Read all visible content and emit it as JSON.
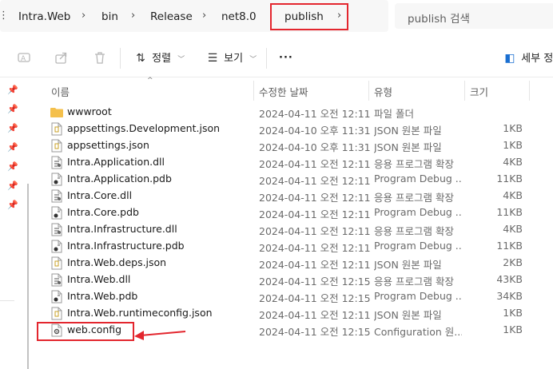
{
  "breadcrumb": {
    "items": [
      "Intra.Web",
      "bin",
      "Release",
      "net8.0",
      "publish"
    ]
  },
  "search": {
    "placeholder": "publish 검색"
  },
  "toolbar": {
    "sort_label": "정렬",
    "view_label": "보기",
    "details_label": "세부 정",
    "more_label": "···"
  },
  "columns": {
    "name": "이름",
    "date": "수정한 날짜",
    "type": "유형",
    "size": "크기"
  },
  "files": [
    {
      "name": "wwwroot",
      "date": "2024-04-11 오전 12:11",
      "type": "파일 폴더",
      "size": "",
      "icon": "folder-icon"
    },
    {
      "name": "appsettings.Development.json",
      "date": "2024-04-10 오후 11:31",
      "type": "JSON 원본 파일",
      "size": "1KB",
      "icon": "json-file-icon"
    },
    {
      "name": "appsettings.json",
      "date": "2024-04-10 오후 11:31",
      "type": "JSON 원본 파일",
      "size": "1KB",
      "icon": "json-file-icon"
    },
    {
      "name": "Intra.Application.dll",
      "date": "2024-04-11 오전 12:11",
      "type": "응용 프로그램 확장",
      "size": "4KB",
      "icon": "dll-file-icon"
    },
    {
      "name": "Intra.Application.pdb",
      "date": "2024-04-11 오전 12:11",
      "type": "Program Debug ...",
      "size": "11KB",
      "icon": "pdb-file-icon"
    },
    {
      "name": "Intra.Core.dll",
      "date": "2024-04-11 오전 12:11",
      "type": "응용 프로그램 확장",
      "size": "4KB",
      "icon": "dll-file-icon"
    },
    {
      "name": "Intra.Core.pdb",
      "date": "2024-04-11 오전 12:11",
      "type": "Program Debug ...",
      "size": "11KB",
      "icon": "pdb-file-icon"
    },
    {
      "name": "Intra.Infrastructure.dll",
      "date": "2024-04-11 오전 12:11",
      "type": "응용 프로그램 확장",
      "size": "4KB",
      "icon": "dll-file-icon"
    },
    {
      "name": "Intra.Infrastructure.pdb",
      "date": "2024-04-11 오전 12:11",
      "type": "Program Debug ...",
      "size": "11KB",
      "icon": "pdb-file-icon"
    },
    {
      "name": "Intra.Web.deps.json",
      "date": "2024-04-11 오전 12:11",
      "type": "JSON 원본 파일",
      "size": "2KB",
      "icon": "json-file-icon"
    },
    {
      "name": "Intra.Web.dll",
      "date": "2024-04-11 오전 12:15",
      "type": "응용 프로그램 확장",
      "size": "43KB",
      "icon": "dll-file-icon"
    },
    {
      "name": "Intra.Web.pdb",
      "date": "2024-04-11 오전 12:15",
      "type": "Program Debug ...",
      "size": "34KB",
      "icon": "pdb-file-icon"
    },
    {
      "name": "Intra.Web.runtimeconfig.json",
      "date": "2024-04-11 오전 12:11",
      "type": "JSON 원본 파일",
      "size": "1KB",
      "icon": "json-file-icon"
    },
    {
      "name": "web.config",
      "date": "2024-04-11 오전 12:15",
      "type": "Configuration 원...",
      "size": "1KB",
      "icon": "config-file-icon"
    }
  ],
  "colors": {
    "highlight": "#e3262e",
    "folder": "#f4c04c"
  }
}
